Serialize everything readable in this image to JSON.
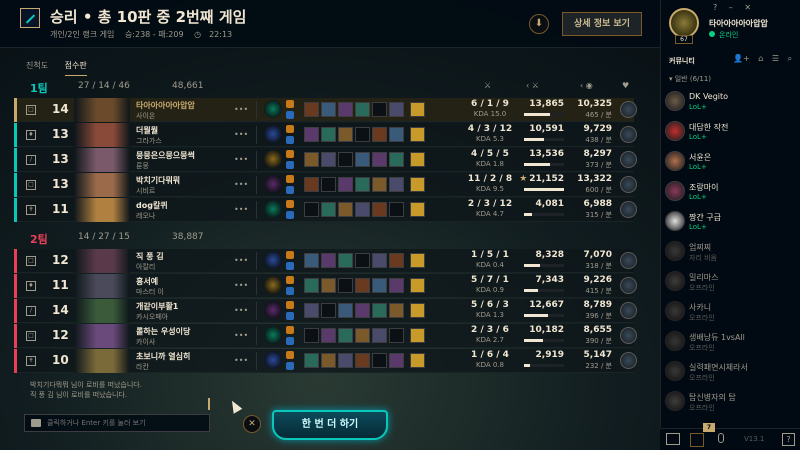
{
  "header": {
    "result_title": "승리 • 총 10판 중 2번째 게임",
    "queue": "개인/2인 랭크 게임",
    "wins_losses": "승:238 - 패:209",
    "duration": "22:13",
    "detail_button": "상세 정보 보기",
    "download_icon": "download-icon"
  },
  "tabs": [
    {
      "label": "진척도",
      "active": false
    },
    {
      "label": "점수판",
      "active": true
    }
  ],
  "columns": {
    "kda": "⚔",
    "damage": "‹ ⚔",
    "gold": "‹ ◉",
    "honor": "♥"
  },
  "teams": [
    {
      "name": "1팀",
      "color": "#0ac8b9",
      "kda": "27 / 14 / 46",
      "gold": "48,661",
      "players": [
        {
          "role": "□",
          "level": "14",
          "name": "타아아아아아압압",
          "champion": "사이온",
          "kda": "6 / 1 / 9",
          "kda_ratio": "KDA 15.0",
          "damage": "13,865",
          "damage_pct": 0.66,
          "gold": "10,325",
          "gpm": "465 / 분",
          "me": true,
          "color": "#c8aa6e",
          "champ_color": "#6a4a2a"
        },
        {
          "role": "♦",
          "level": "13",
          "name": "더뭘뭘",
          "champion": "그라가스",
          "kda": "4 / 3 / 12",
          "kda_ratio": "KDA 5.3",
          "damage": "10,591",
          "damage_pct": 0.5,
          "gold": "9,729",
          "gpm": "438 / 분",
          "me": false,
          "color": "#0ac8b9",
          "champ_color": "#8a4a3a"
        },
        {
          "role": "∕",
          "level": "13",
          "name": "뭉뭉은으뭉으뭉썩",
          "champion": "룬뭉",
          "kda": "4 / 5 / 5",
          "kda_ratio": "KDA 1.8",
          "damage": "13,536",
          "damage_pct": 0.64,
          "gold": "8,297",
          "gpm": "373 / 분",
          "me": false,
          "color": "#0ac8b9",
          "champ_color": "#7a5a6a"
        },
        {
          "role": "□",
          "level": "13",
          "name": "박치기다뭐뭐",
          "champion": "시비르",
          "kda": "11 / 2 / 8",
          "kda_ratio": "KDA 9.5",
          "damage": "21,152",
          "damage_pct": 1.0,
          "gold": "13,322",
          "gpm": "600 / 분",
          "me": false,
          "color": "#0ac8b9",
          "champ_color": "#9a6a4a",
          "mvp": "★"
        },
        {
          "role": "✝",
          "level": "11",
          "name": "dog칼퀴",
          "champion": "레오나",
          "kda": "2 / 3 / 12",
          "kda_ratio": "KDA 4.7",
          "damage": "4,081",
          "damage_pct": 0.19,
          "gold": "6,988",
          "gpm": "315 / 분",
          "me": false,
          "color": "#0ac8b9",
          "champ_color": "#b08040"
        }
      ]
    },
    {
      "name": "2팀",
      "color": "#e84057",
      "kda": "14 / 27 / 15",
      "gold": "38,887",
      "players": [
        {
          "role": "□",
          "level": "12",
          "name": "직 풍 김",
          "champion": "아칼리",
          "kda": "1 / 5 / 1",
          "kda_ratio": "KDA 0.4",
          "damage": "8,328",
          "damage_pct": 0.39,
          "gold": "7,070",
          "gpm": "318 / 분",
          "me": false,
          "color": "#e84057",
          "champ_color": "#5a3a4a"
        },
        {
          "role": "♦",
          "level": "11",
          "name": "흉서예",
          "champion": "마스터 이",
          "kda": "5 / 7 / 1",
          "kda_ratio": "KDA 0.9",
          "damage": "7,343",
          "damage_pct": 0.35,
          "gold": "9,226",
          "gpm": "415 / 분",
          "me": false,
          "color": "#e84057",
          "champ_color": "#4a4a5a"
        },
        {
          "role": "∕",
          "level": "14",
          "name": "개같이부활1",
          "champion": "카시오페아",
          "kda": "5 / 6 / 3",
          "kda_ratio": "KDA 1.3",
          "damage": "12,667",
          "damage_pct": 0.6,
          "gold": "8,789",
          "gpm": "396 / 분",
          "me": false,
          "color": "#e84057",
          "champ_color": "#3a5a3a"
        },
        {
          "role": "□",
          "level": "12",
          "name": "롤하는 우성이당",
          "champion": "카이사",
          "kda": "2 / 3 / 6",
          "kda_ratio": "KDA 2.7",
          "damage": "10,182",
          "damage_pct": 0.48,
          "gold": "8,655",
          "gpm": "390 / 분",
          "me": false,
          "color": "#e84057",
          "champ_color": "#6a4a7a"
        },
        {
          "role": "✝",
          "level": "10",
          "name": "초보니까 열심히",
          "champion": "라칸",
          "kda": "1 / 6 / 4",
          "kda_ratio": "KDA 0.8",
          "damage": "2,919",
          "damage_pct": 0.14,
          "gold": "5,147",
          "gpm": "232 / 분",
          "me": false,
          "color": "#e84057",
          "champ_color": "#7a6a3a"
        }
      ]
    }
  ],
  "chat": {
    "lines": [
      "박치기다뭐뭐 님이 로비를 떠났습니다.",
      "직 풍 김 님이 로비를 떠났습니다."
    ],
    "placeholder": "클릭하거나 Enter 키를 눌러 보기"
  },
  "footer": {
    "play_again": "한 번 더 하기",
    "close": "✕"
  },
  "social": {
    "top_icons": [
      "?",
      "–",
      "✕"
    ],
    "profile": {
      "name": "타아아아아아압압",
      "status": "온라인",
      "level": "67"
    },
    "community_label": "커뮤니티",
    "community_icons": [
      "👤+",
      "⌂",
      "☰",
      "⌕"
    ],
    "group": "▾ 일반 (6/11)",
    "friends": [
      {
        "name": "DK Vegito",
        "status": "LoL+",
        "online": true,
        "color": "#6a5a4a"
      },
      {
        "name": "대답한 작전",
        "status": "LoL+",
        "online": true,
        "color": "#c03030"
      },
      {
        "name": "서윤은",
        "status": "LoL+",
        "online": true,
        "color": "#b07050"
      },
      {
        "name": "조랑마이",
        "status": "LoL+",
        "online": true,
        "color": "#8a3a5a"
      },
      {
        "name": "짱간 구급",
        "status": "LoL+",
        "online": true,
        "color": "#e0e0e0"
      },
      {
        "name": "엄찌찌",
        "status": "자리 비움",
        "online": false,
        "color": "#7a5a3a"
      },
      {
        "name": "밀리마스",
        "status": "오프라인",
        "online": false,
        "color": "#5a6a4a"
      },
      {
        "name": "사카니",
        "status": "오프라인",
        "online": false,
        "color": "#6a5a6a"
      },
      {
        "name": "생배낭듀 1vsAll",
        "status": "오프라인",
        "online": false,
        "color": "#5a5a5a"
      },
      {
        "name": "실력패면시체라서",
        "status": "오프라인",
        "online": false,
        "color": "#6a5a5a"
      },
      {
        "name": "탑신병자의 탑",
        "status": "오프라인",
        "online": false,
        "color": "#5a6a6a"
      }
    ],
    "bottom": {
      "mission_count": "7",
      "version": "V13.1",
      "help": "?"
    }
  }
}
